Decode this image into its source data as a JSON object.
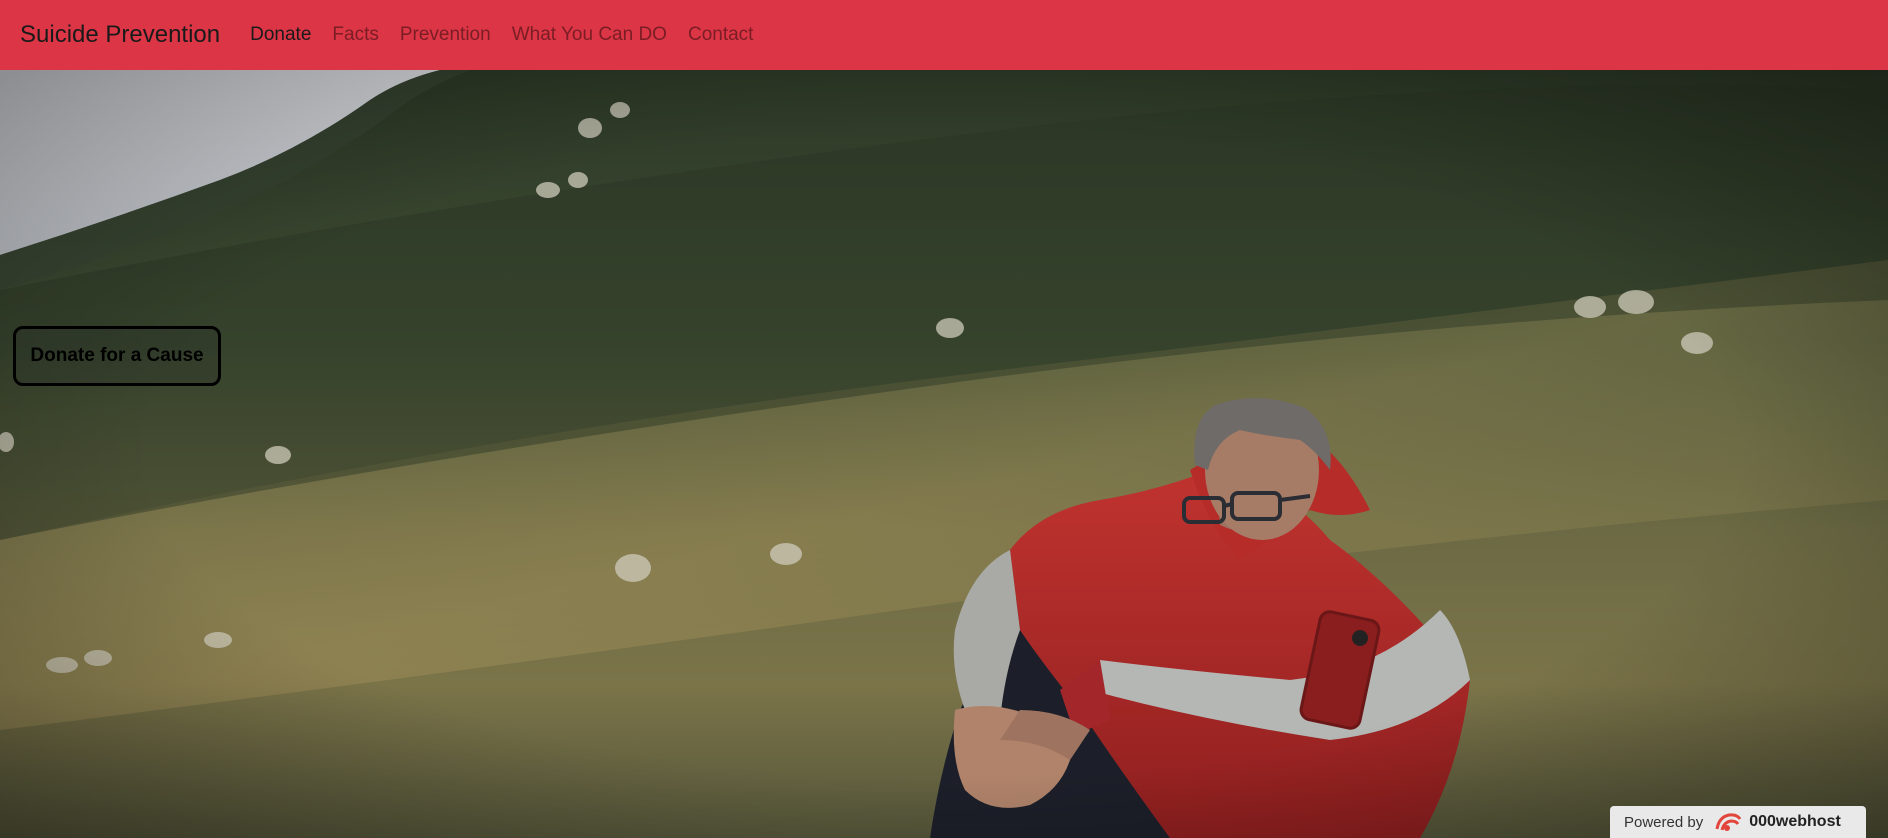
{
  "navbar": {
    "brand": "Suicide Prevention",
    "links": [
      {
        "label": "Donate",
        "active": true
      },
      {
        "label": "Facts",
        "active": false
      },
      {
        "label": "Prevention",
        "active": false
      },
      {
        "label": "What You Can DO",
        "active": false
      },
      {
        "label": "Contact",
        "active": false
      }
    ]
  },
  "hero": {
    "cta_label": "Donate for a Cause"
  },
  "badge": {
    "prefix": "Powered by",
    "brand": "000webhost"
  },
  "colors": {
    "navbar_bg": "#dc3545",
    "active_link": "#1a1a1a",
    "inactive_link": "#7a1d25"
  }
}
